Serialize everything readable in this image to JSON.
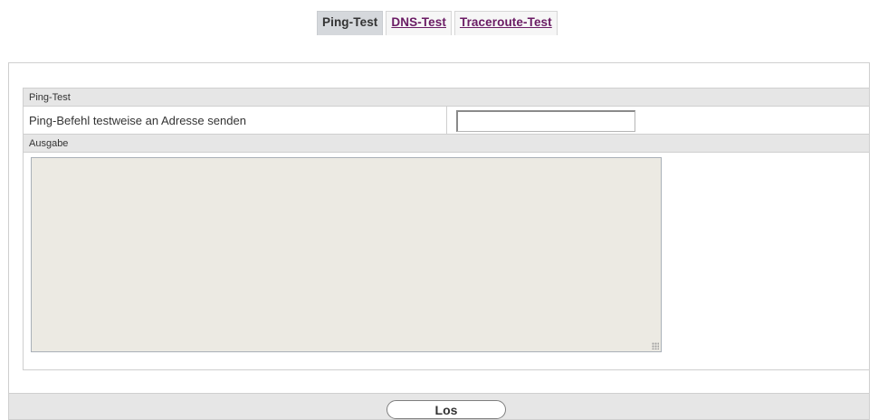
{
  "tabs": [
    {
      "label": "Ping-Test",
      "active": true
    },
    {
      "label": "DNS-Test",
      "active": false
    },
    {
      "label": "Traceroute-Test",
      "active": false
    }
  ],
  "ping_section": {
    "heading": "Ping-Test",
    "address_label": "Ping-Befehl testweise an Adresse senden",
    "address_value": ""
  },
  "output_section": {
    "heading": "Ausgabe",
    "output_value": ""
  },
  "footer": {
    "go_label": "Los"
  },
  "colors": {
    "tab_link": "#6a1b64",
    "section_bg": "#e6e6e6",
    "output_bg": "#eceae3"
  }
}
